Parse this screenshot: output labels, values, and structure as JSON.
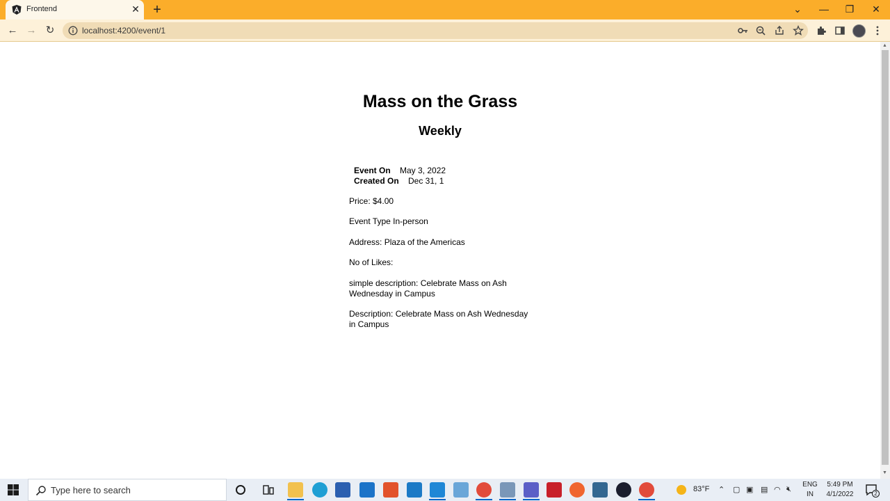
{
  "browser": {
    "tab_title": "Frontend",
    "url": "localhost:4200/event/1"
  },
  "event": {
    "title": "Mass on the Grass",
    "subtitle": "Weekly",
    "event_on_label": "Event On",
    "event_on_value": "May 3, 2022",
    "created_on_label": "Created On",
    "created_on_value": "Dec 31, 1",
    "price": "Price: $4.00",
    "event_type": "Event Type In-person",
    "address": "Address: Plaza of the Americas",
    "likes": "No of Likes:",
    "simple_description": "simple description: Celebrate Mass on Ash Wednesday in Campus",
    "description": "Description: Celebrate Mass on Ash Wednesday in Campus"
  },
  "taskbar": {
    "search_placeholder": "Type here to search",
    "weather": "83°F",
    "lang_line1": "ENG",
    "lang_line2": "IN",
    "time": "5:49 PM",
    "date": "4/1/2022",
    "notification_count": "2"
  },
  "colors": {
    "tabstrip": "#fbad2a",
    "toolbar": "#fdf1d9",
    "taskbar": "#e9eef5"
  }
}
